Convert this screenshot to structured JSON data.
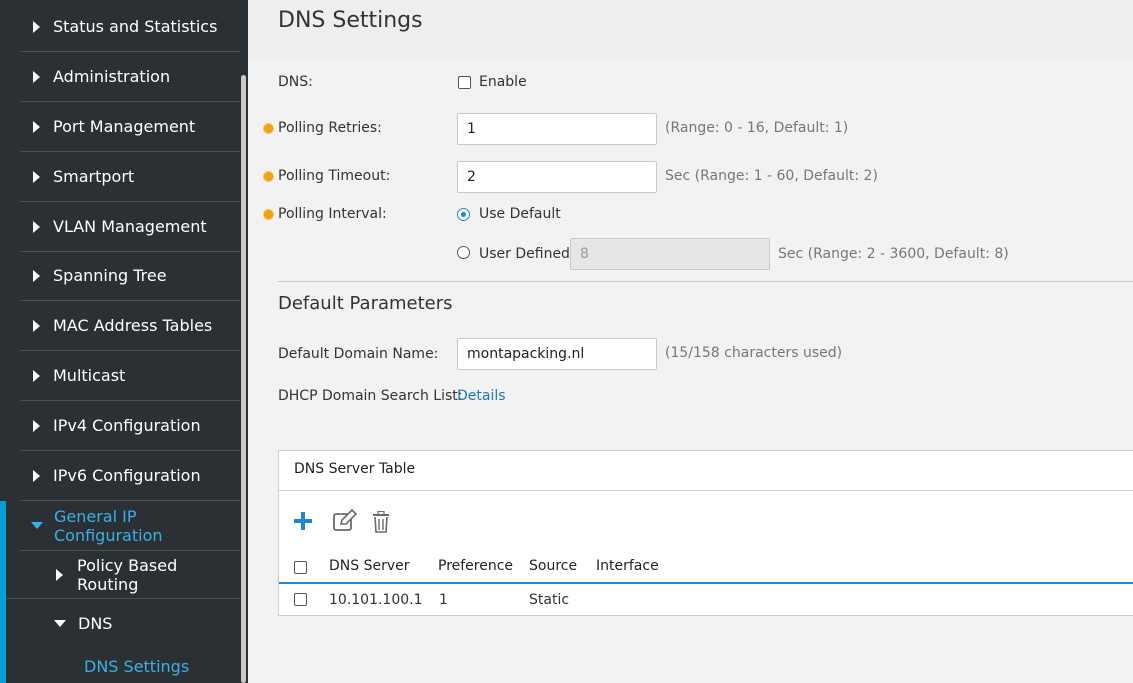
{
  "sidebar": {
    "items": [
      {
        "label": "Status and Statistics"
      },
      {
        "label": "Administration"
      },
      {
        "label": "Port Management"
      },
      {
        "label": "Smartport"
      },
      {
        "label": "VLAN Management"
      },
      {
        "label": "Spanning Tree"
      },
      {
        "label": "MAC Address Tables"
      },
      {
        "label": "Multicast"
      },
      {
        "label": "IPv4 Configuration"
      },
      {
        "label": "IPv6 Configuration"
      },
      {
        "label": "General IP Configuration"
      }
    ],
    "sub_items": [
      {
        "label": "Policy Based Routing"
      },
      {
        "label": "DNS"
      }
    ],
    "leaf": {
      "label": "DNS Settings"
    }
  },
  "page": {
    "title": "DNS Settings"
  },
  "form": {
    "dns_label": "DNS:",
    "enable_label": "Enable",
    "enable_checked": false,
    "retries_label": "Polling Retries:",
    "retries_value": "1",
    "retries_hint": "(Range: 0 - 16, Default: 1)",
    "timeout_label": "Polling Timeout:",
    "timeout_value": "2",
    "timeout_hint": "Sec (Range: 1 - 60, Default: 2)",
    "interval_label": "Polling Interval:",
    "use_default_label": "Use Default",
    "user_defined_label": "User Defined",
    "user_defined_value": "8",
    "user_defined_hint": "Sec (Range: 2 - 3600, Default: 8)"
  },
  "defaults": {
    "section_title": "Default Parameters",
    "domain_label": "Default Domain Name:",
    "domain_value": "montapacking.nl",
    "domain_hint": "(15/158 characters used)",
    "dhcp_label": "DHCP Domain Search List:",
    "dhcp_link": "Details"
  },
  "dns_table": {
    "caption": "DNS Server Table",
    "columns": [
      "DNS Server",
      "Preference",
      "Source",
      "Interface"
    ],
    "rows": [
      {
        "server": "10.101.100.1",
        "preference": "1",
        "source": "Static",
        "interface": ""
      }
    ]
  },
  "icons": {
    "add": "plus-icon",
    "edit": "edit-icon",
    "delete": "trash-icon"
  },
  "colors": {
    "sidebar_bg": "#2b3034",
    "accent": "#049fd9",
    "link": "#1f7ab8",
    "required": "#f0a30a"
  }
}
